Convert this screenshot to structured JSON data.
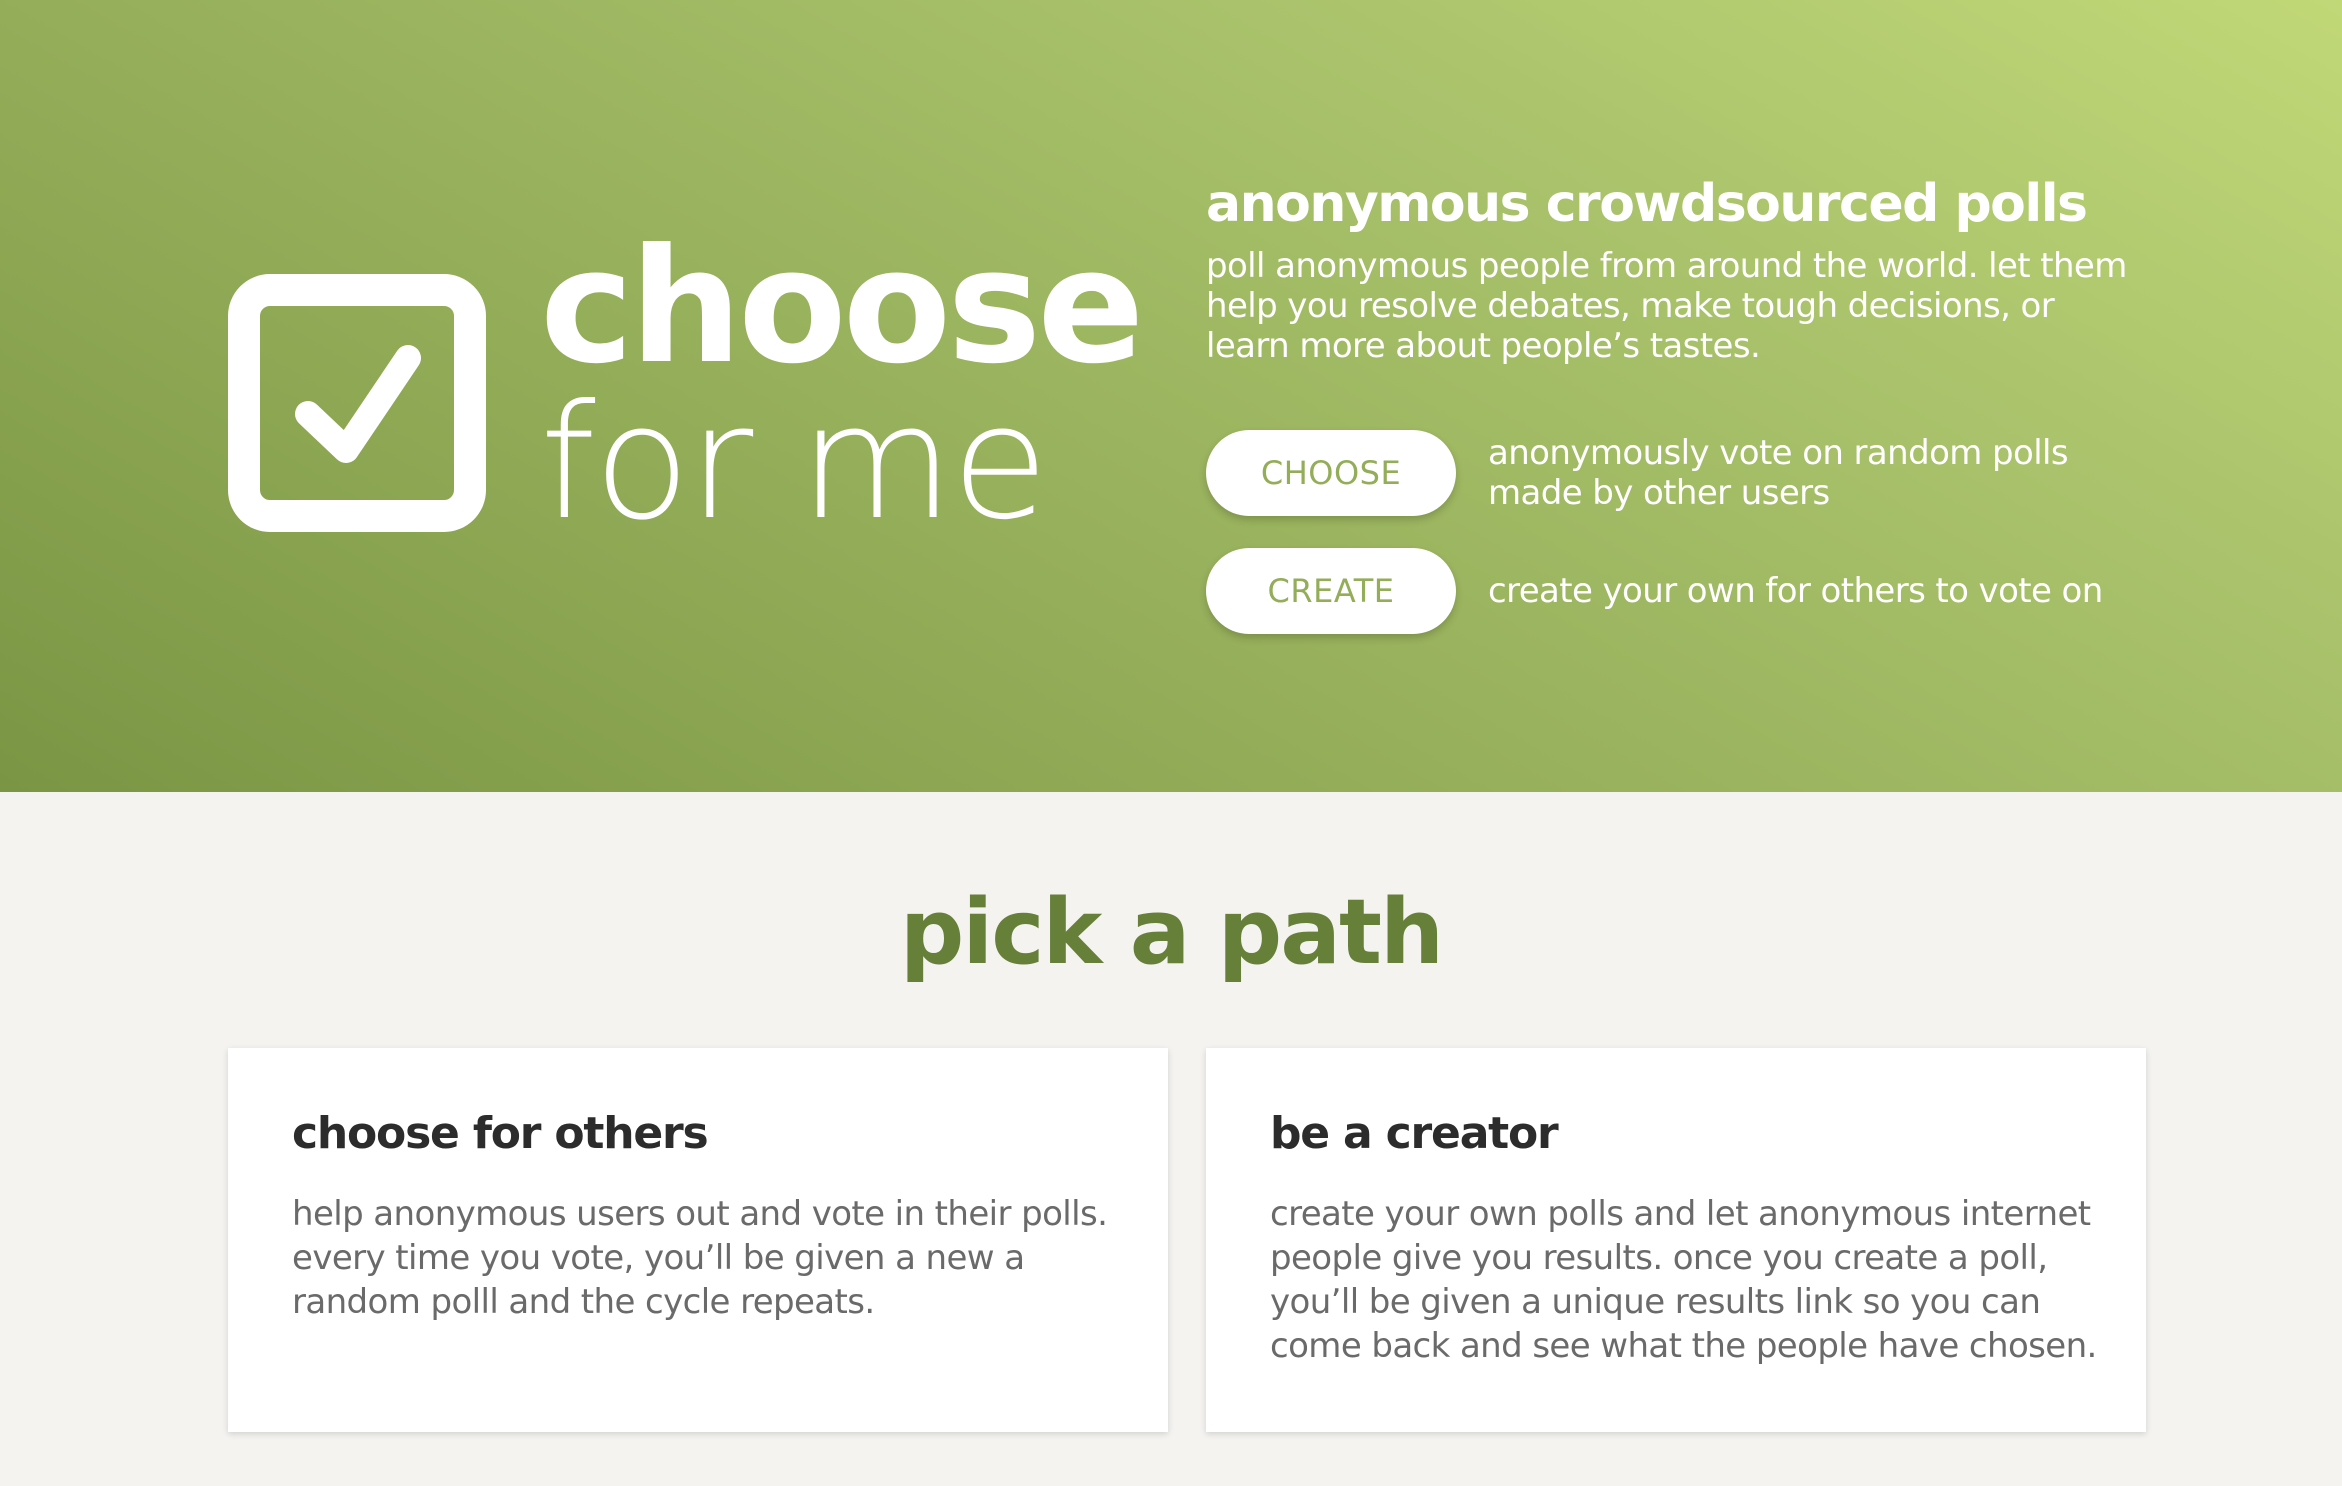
{
  "brand": {
    "icon": "checkbox-checked-icon",
    "name_line1": "choose",
    "name_line2": "for me"
  },
  "hero": {
    "tagline": "anonymous crowdsourced polls",
    "intro": "poll anonymous people from around the world. let them help you resolve debates, make tough decisions, or learn more about people’s tastes.",
    "actions": [
      {
        "label": "CHOOSE",
        "description": "anonymously vote on random polls made by other users"
      },
      {
        "label": "CREATE",
        "description": "create your own for others to vote on"
      }
    ]
  },
  "paths": {
    "title": "pick a path",
    "cards": [
      {
        "title": "choose for others",
        "body": "help anonymous users out and vote in their polls. every time you vote, you’ll be given a new a random polll and the cycle repeats."
      },
      {
        "title": "be a creator",
        "body": "create your own polls and let anonymous internet people give you results. once you create a poll, you’ll be given a unique results link so you can come back and see what the people have chosen."
      }
    ]
  },
  "colors": {
    "brand_green_dark": "#7a9644",
    "brand_green_light": "#c1d877",
    "accent_text": "#93ad58",
    "section_title": "#66803a",
    "page_background": "#f4f3f0"
  }
}
